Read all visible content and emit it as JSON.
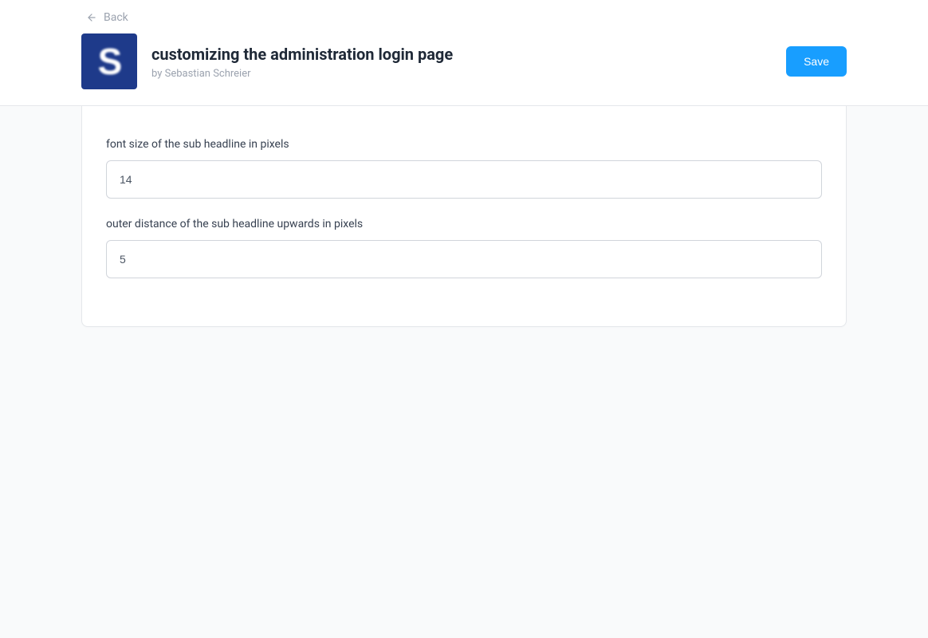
{
  "header": {
    "back_label": "Back",
    "title": "customizing the administration login page",
    "byline": "by Sebastian Schreier",
    "save_label": "Save",
    "logo_letter": "S"
  },
  "form": {
    "fields": [
      {
        "label": "font size of the sub headline in pixels",
        "value": "14"
      },
      {
        "label": "outer distance of the sub headline upwards in pixels",
        "value": "5"
      }
    ]
  }
}
